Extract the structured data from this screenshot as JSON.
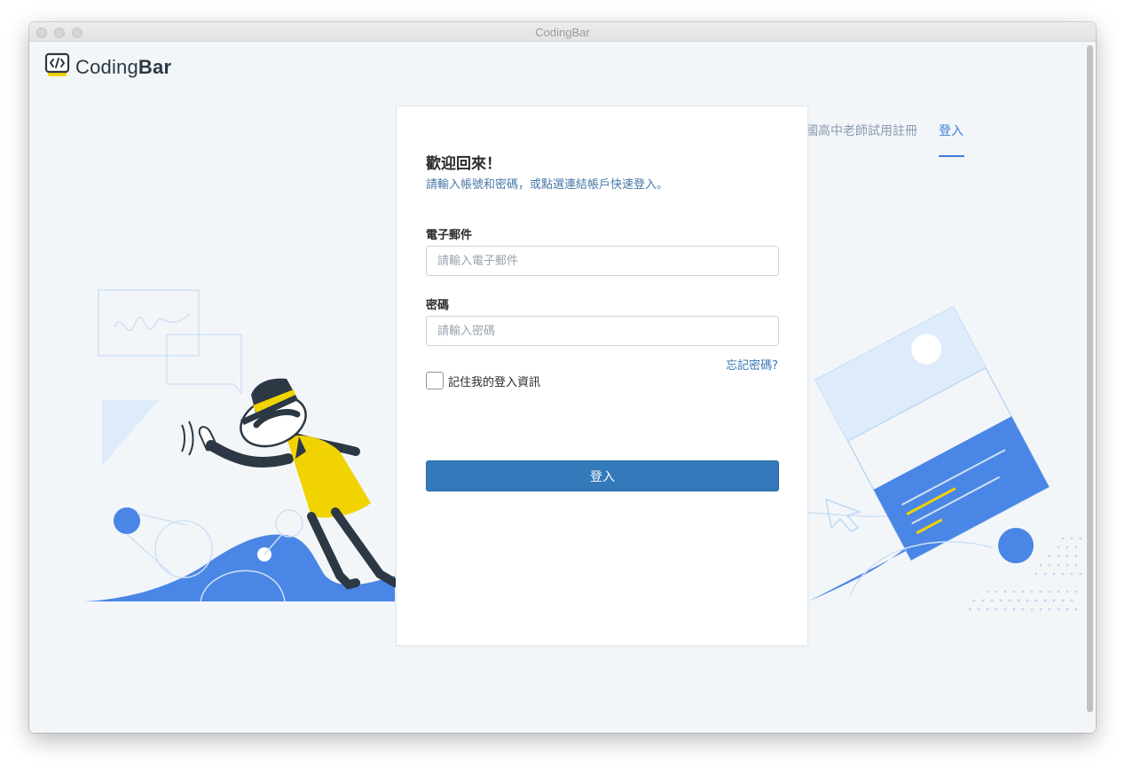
{
  "window": {
    "title": "CodingBar"
  },
  "brand": {
    "name_regular": "Coding",
    "name_bold": "Bar"
  },
  "nav": {
    "teacher_register": "國高中老師試用註冊",
    "login": "登入"
  },
  "login_card": {
    "title": "歡迎回來！",
    "subtitle": "請輸入帳號和密碼，或點選連結帳戶快速登入。",
    "email": {
      "label": "電子郵件",
      "placeholder": "請輸入電子郵件",
      "value": ""
    },
    "password": {
      "label": "密碼",
      "placeholder": "請輸入密碼",
      "value": ""
    },
    "forgot_password": "忘記密碼?",
    "remember_me": {
      "label": "記住我的登入資訊",
      "checked": false
    },
    "submit": "登入"
  },
  "colors": {
    "accent": "#3b7fd9",
    "button": "#3479b9",
    "illustration_blue": "#4a86e6",
    "illustration_yellow": "#f0d300",
    "background": "#f3f6f9"
  },
  "icons": {
    "logo": "code-bracket-icon",
    "window_controls": [
      "close-dot-icon",
      "minimize-dot-icon",
      "zoom-dot-icon"
    ]
  }
}
